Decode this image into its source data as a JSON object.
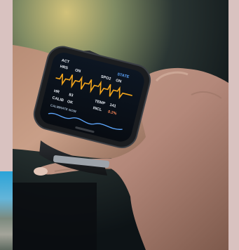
{
  "photo": {
    "subject": "smartwatch-on-wrist",
    "screen": {
      "rows": [
        {
          "label": "ACT",
          "value": "STATE"
        },
        {
          "label": "HRS",
          "value": "ON"
        },
        {
          "label": "SPO2",
          "value": "ON"
        },
        {
          "label": "HR",
          "value": "83"
        },
        {
          "label": "TEMP",
          "value": "141"
        },
        {
          "label": "CALIB",
          "value": "OK"
        },
        {
          "label": "INCL",
          "value": "0.2%"
        }
      ],
      "footer_label": "CALIBRATE NOW",
      "wave_color": "#f3a51c",
      "text_color": "#e9eef5",
      "accent_color": "#5fa8ff"
    }
  },
  "colors": {
    "background": "#d8bfbd",
    "skin": "#caa58f",
    "strap": "#1d1f22",
    "bezel": "#2a2d31"
  }
}
